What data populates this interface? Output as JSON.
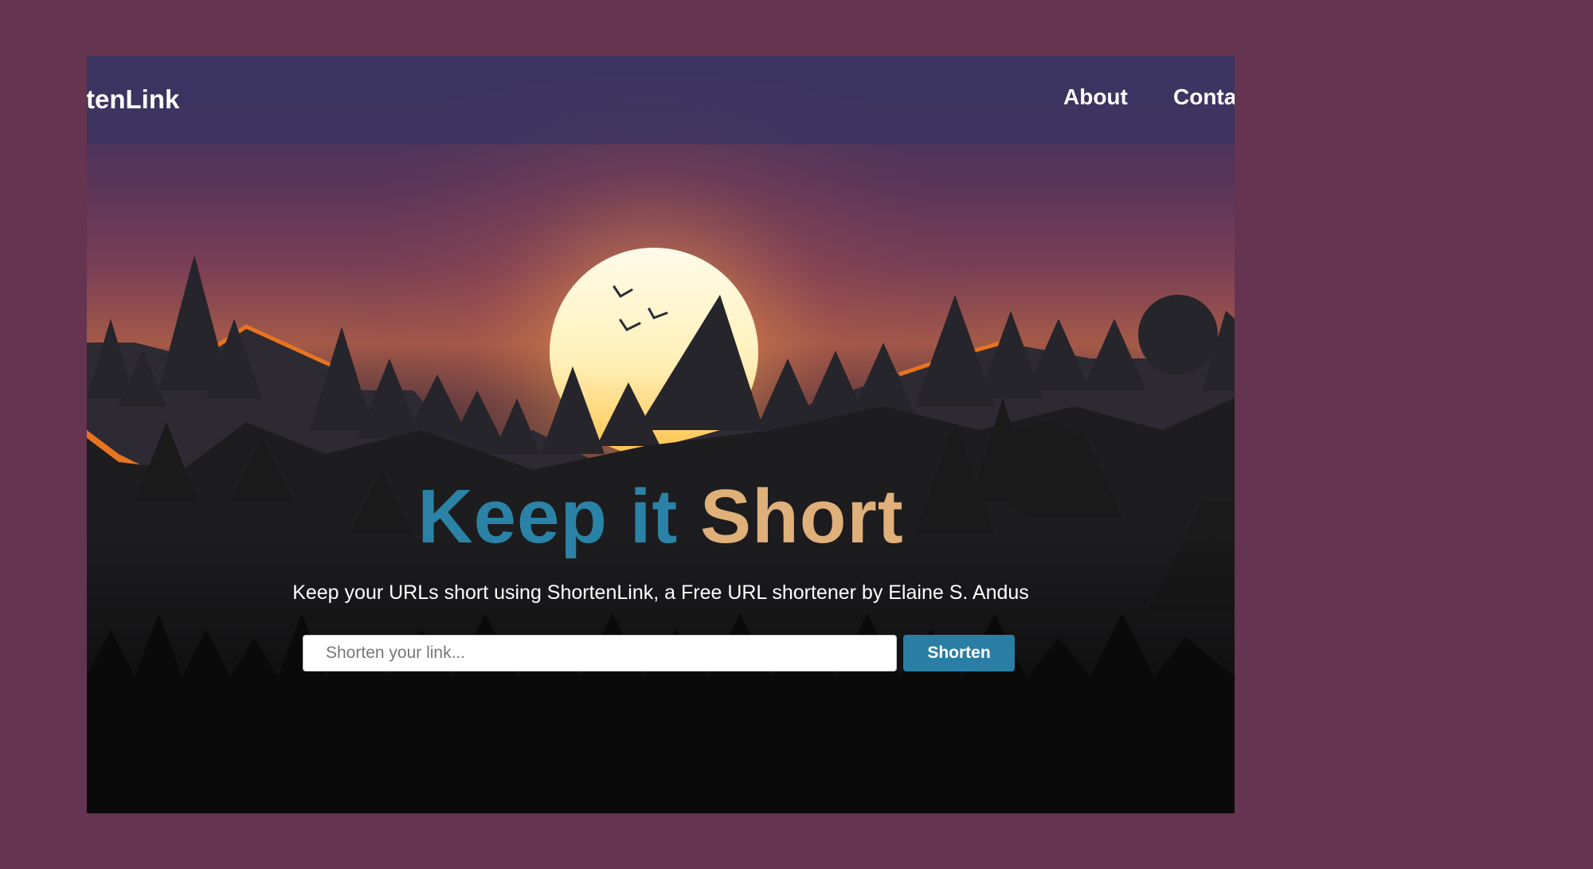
{
  "navbar": {
    "brand": "ortenLink",
    "links": [
      {
        "label": "About"
      },
      {
        "label": "Conta"
      }
    ]
  },
  "hero": {
    "headline_part1": "Keep it",
    "headline_part2": "Short",
    "subtitle": "Keep your URLs short using ShortenLink, a Free URL shortener by Elaine S. Andus"
  },
  "form": {
    "input_placeholder": "Shorten your link...",
    "input_value": "",
    "button_label": "Shorten"
  },
  "colors": {
    "page_background": "#653450",
    "headline_accent_blue": "#2a83a6",
    "headline_accent_tan": "#e0b07a",
    "button": "#2a7ea4"
  }
}
